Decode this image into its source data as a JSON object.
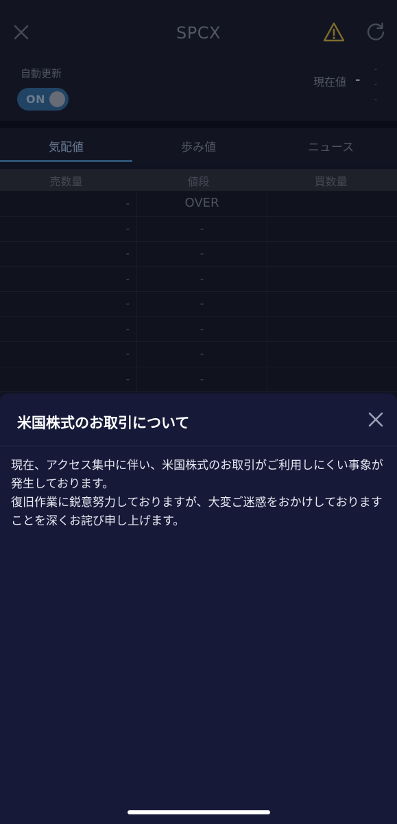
{
  "header": {
    "title": "SPCX"
  },
  "status": {
    "auto_update_label": "自動更新",
    "toggle_label": "ON",
    "current_price_label": "現在値",
    "current_price_value": "-",
    "change_line1": "-",
    "change_line2": "-",
    "change_line3": "-"
  },
  "tabs": [
    {
      "label": "気配値",
      "active": true
    },
    {
      "label": "歩み値",
      "active": false
    },
    {
      "label": "ニュース",
      "active": false
    }
  ],
  "table": {
    "headers": [
      "売数量",
      "値段",
      "買数量"
    ],
    "rows": [
      {
        "sell": "-",
        "price": "OVER",
        "buy": ""
      },
      {
        "sell": "-",
        "price": "-",
        "buy": ""
      },
      {
        "sell": "-",
        "price": "-",
        "buy": ""
      },
      {
        "sell": "-",
        "price": "-",
        "buy": ""
      },
      {
        "sell": "-",
        "price": "-",
        "buy": ""
      },
      {
        "sell": "-",
        "price": "-",
        "buy": ""
      },
      {
        "sell": "-",
        "price": "-",
        "buy": ""
      },
      {
        "sell": "-",
        "price": "-",
        "buy": ""
      }
    ]
  },
  "sheet": {
    "title": "米国株式のお取引について",
    "body": "現在、アクセス集中に伴い、米国株式のお取引がご利用しにくい事象が発生しております。\n復旧作業に鋭意努力しておりますが、大変ご迷惑をおかけしておりますことを深くお詫び申し上げます。"
  },
  "colors": {
    "background": "#161a2d",
    "sheet_background": "#161a38",
    "accent": "#3f6f9c",
    "warning": "#b8a24a"
  },
  "icons": {
    "close": "close-icon",
    "warning": "warning-icon",
    "refresh": "refresh-icon"
  }
}
